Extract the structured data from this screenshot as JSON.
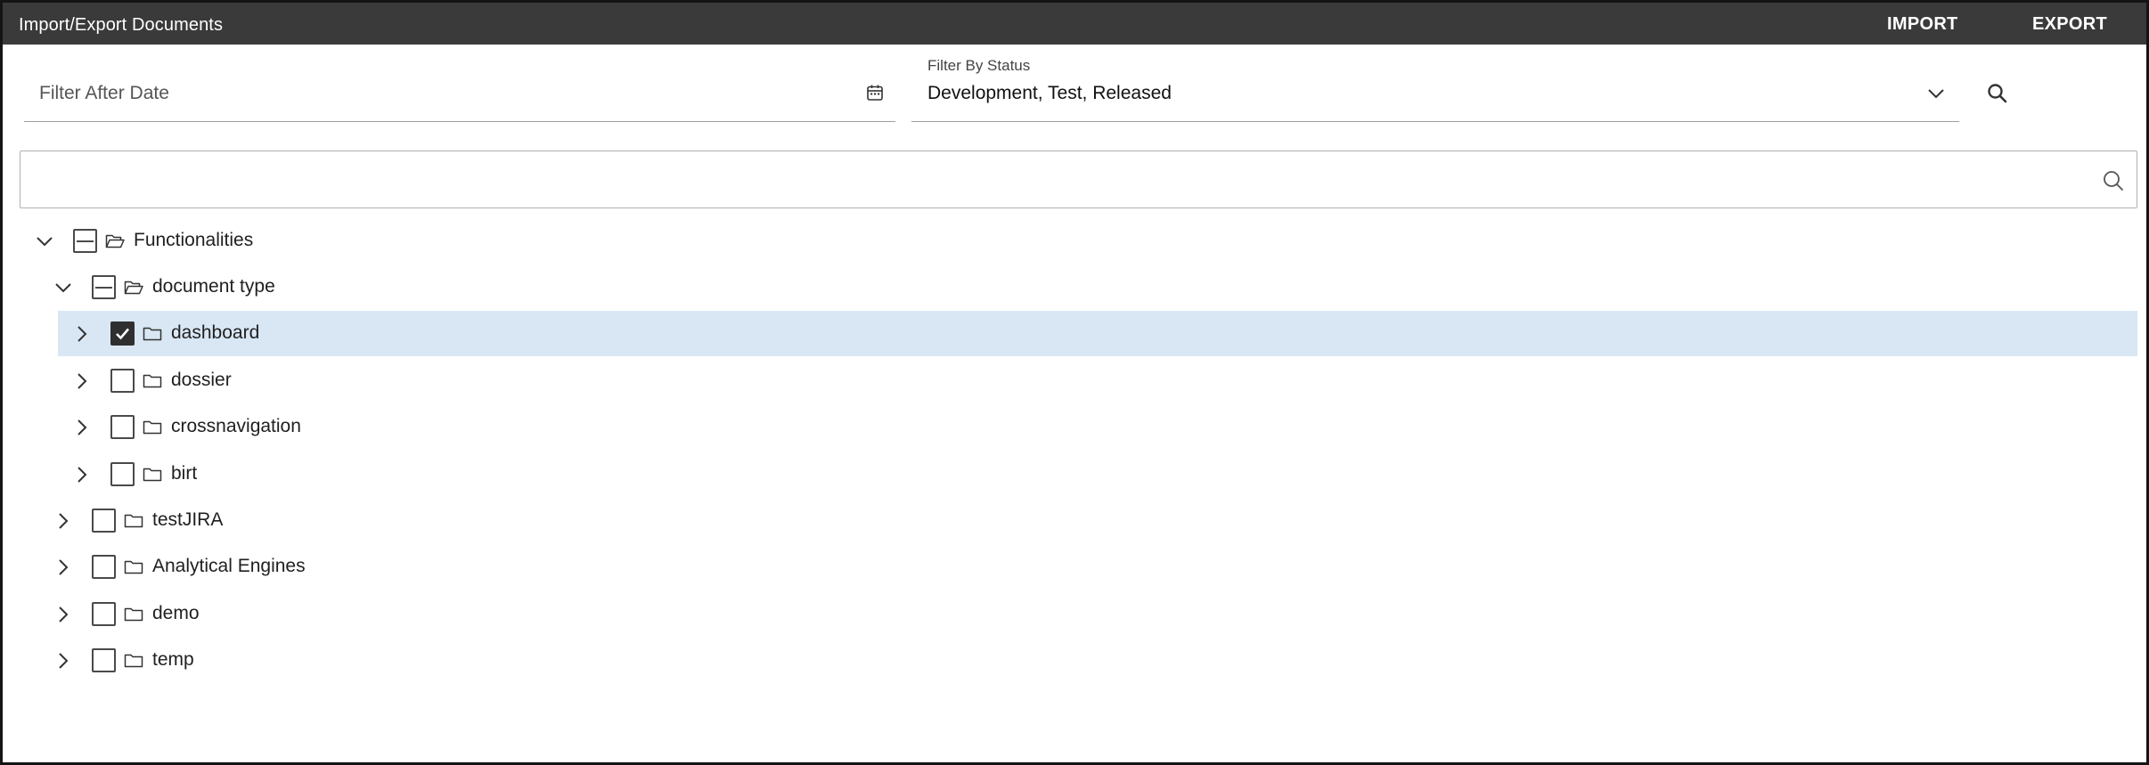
{
  "toolbar": {
    "title": "Import/Export Documents",
    "import_label": "IMPORT",
    "export_label": "EXPORT"
  },
  "filters": {
    "date_placeholder": "Filter After Date",
    "status_label": "Filter By Status",
    "status_value": "Development, Test, Released"
  },
  "tree_search": {
    "value": ""
  },
  "tree": [
    {
      "label": "Functionalities",
      "expanded": true,
      "check": "partial",
      "icon": "folder-open-icon"
    },
    {
      "label": "document type",
      "expanded": true,
      "check": "partial",
      "icon": "folder-open-icon"
    },
    {
      "label": "dashboard",
      "expanded": false,
      "check": "checked",
      "icon": "folder-icon",
      "selected": true
    },
    {
      "label": "dossier",
      "expanded": false,
      "check": "unchecked",
      "icon": "folder-icon"
    },
    {
      "label": "crossnavigation",
      "expanded": false,
      "check": "unchecked",
      "icon": "folder-icon"
    },
    {
      "label": "birt",
      "expanded": false,
      "check": "unchecked",
      "icon": "folder-icon"
    },
    {
      "label": "testJIRA",
      "expanded": false,
      "check": "unchecked",
      "icon": "folder-icon"
    },
    {
      "label": "Analytical Engines",
      "expanded": false,
      "check": "unchecked",
      "icon": "folder-icon"
    },
    {
      "label": "demo",
      "expanded": false,
      "check": "unchecked",
      "icon": "folder-icon"
    },
    {
      "label": "temp",
      "expanded": false,
      "check": "unchecked",
      "icon": "folder-icon"
    }
  ]
}
